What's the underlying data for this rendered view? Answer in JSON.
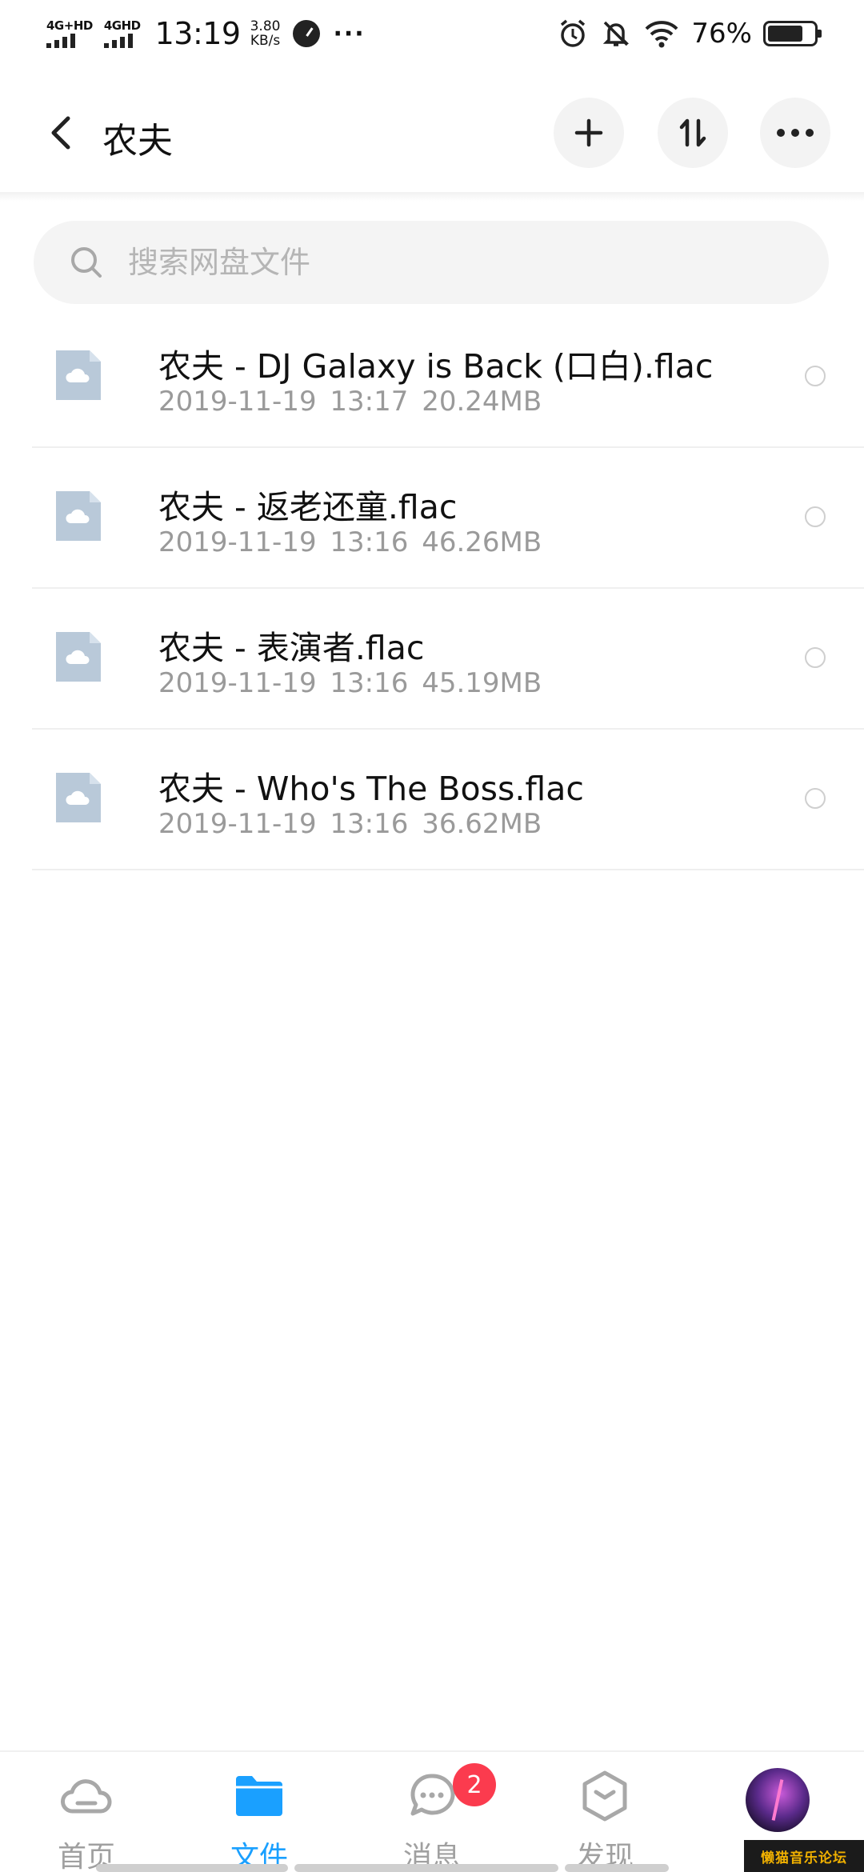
{
  "status_bar": {
    "sim1": "4G+HD",
    "sim2": "4GHD",
    "time": "13:19",
    "speed_value": "3.80",
    "speed_unit": "KB/s",
    "more": "···",
    "battery_percent": "76%",
    "battery_level": 0.76
  },
  "header": {
    "title": "农夫"
  },
  "search": {
    "placeholder": "搜索网盘文件"
  },
  "files": [
    {
      "name": "农夫 - DJ Galaxy is Back (口白).flac",
      "date": "2019-11-19",
      "time": "13:17",
      "size": "20.24MB"
    },
    {
      "name": "农夫 - 返老还童.flac",
      "date": "2019-11-19",
      "time": "13:16",
      "size": "46.26MB"
    },
    {
      "name": "农夫 - 表演者.flac",
      "date": "2019-11-19",
      "time": "13:16",
      "size": "45.19MB"
    },
    {
      "name": "农夫 - Who's The Boss.flac",
      "date": "2019-11-19",
      "time": "13:16",
      "size": "36.62MB"
    }
  ],
  "nav": {
    "home": "首页",
    "files": "文件",
    "messages": "消息",
    "messages_badge": "2",
    "discover": "发现"
  },
  "watermark": "懒猫音乐论坛",
  "colors": {
    "accent": "#1aa0ff",
    "badge": "#fb3b4e",
    "file_icon": "#b9c9d9"
  }
}
